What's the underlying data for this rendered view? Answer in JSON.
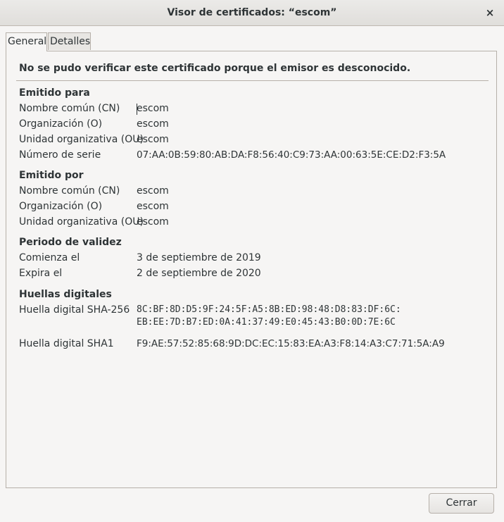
{
  "window": {
    "title": "Visor de certificados: “escom”",
    "close_icon": "×"
  },
  "tabs": [
    {
      "label": "General",
      "active": true
    },
    {
      "label": "Detalles",
      "active": false
    }
  ],
  "warning": "No se pudo verificar este certificado porque el emisor es desconocido.",
  "issued_to": {
    "title": "Emitido para",
    "rows": [
      {
        "label": "Nombre común (CN)",
        "value": "escom"
      },
      {
        "label": "Organización (O)",
        "value": "escom"
      },
      {
        "label": "Unidad organizativa (OU)",
        "value": "escom"
      },
      {
        "label": "Número de serie",
        "value": "07:AA:0B:59:80:AB:DA:F8:56:40:C9:73:AA:00:63:5E:CE:D2:F3:5A"
      }
    ]
  },
  "issued_by": {
    "title": "Emitido por",
    "rows": [
      {
        "label": "Nombre común (CN)",
        "value": "escom"
      },
      {
        "label": "Organización (O)",
        "value": "escom"
      },
      {
        "label": "Unidad organizativa (OU)",
        "value": "escom"
      }
    ]
  },
  "validity": {
    "title": "Periodo de validez",
    "rows": [
      {
        "label": "Comienza el",
        "value": "3 de septiembre de 2019"
      },
      {
        "label": "Expira el",
        "value": "2 de septiembre de 2020"
      }
    ]
  },
  "fingerprints": {
    "title": "Huellas digitales",
    "sha256_label": "Huella digital SHA-256",
    "sha256_line1": "8C:BF:8D:D5:9F:24:5F:A5:8B:ED:98:48:D8:83:DF:6C:",
    "sha256_line2": "EB:EE:7D:B7:ED:0A:41:37:49:E0:45:43:B0:0D:7E:6C",
    "sha1_label": "Huella digital SHA1",
    "sha1_value": "F9:AE:57:52:85:68:9D:DC:EC:15:83:EA:A3:F8:14:A3:C7:71:5A:A9"
  },
  "footer": {
    "close_label": "Cerrar"
  }
}
